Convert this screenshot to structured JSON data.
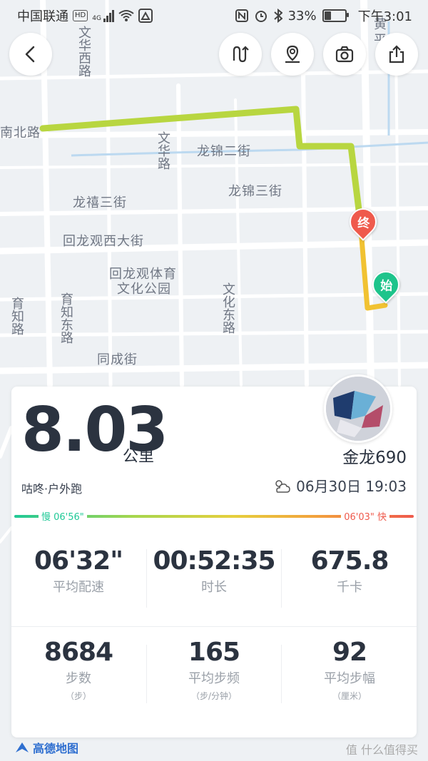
{
  "status_bar": {
    "carrier": "中国联通",
    "hd_badge": "HD",
    "network": "4G",
    "battery": "33%",
    "battery_level": 0.33,
    "time": "下午3:01"
  },
  "map": {
    "labels": {
      "wenhua_west": "文华西路",
      "north_road": "南北路",
      "wenhua_road": "文华路",
      "longjin_2": "龙锦二街",
      "longjin_3": "龙锦三街",
      "longxi_3": "龙禧三街",
      "huilongguan_west": "回龙观西大街",
      "park_1": "回龙观体育",
      "park_2": "文化公园",
      "yuzhi": "育知路",
      "yuzhi_east": "育知东路",
      "wenhua_east": "文化东路",
      "tongcheng": "同成街",
      "huangping_1": "黄",
      "huangping_2": "平"
    },
    "start_marker": "始",
    "end_marker": "终",
    "colors": {
      "start": "#1ec48b",
      "end": "#ef5a4c",
      "route": "#b8d640",
      "route_end": "#f1c232"
    }
  },
  "buttons": {
    "back": "back-arrow-icon",
    "route": "route-icon",
    "location": "location-pin-icon",
    "camera": "camera-icon",
    "share": "share-icon"
  },
  "summary": {
    "distance": "8.03",
    "distance_unit": "公里",
    "username": "金龙690",
    "activity": "咕咚·户外跑",
    "weather_icon": "cloudy-sun-icon",
    "date": "06月30日 19:03",
    "pace_slow_label": "慢 06'56\"",
    "pace_fast_label": "06'03\" 快",
    "colors": {
      "slow": "#20c997",
      "fast": "#ef5a4c"
    }
  },
  "stats": [
    {
      "value": "06'32\"",
      "label": "平均配速",
      "unit": ""
    },
    {
      "value": "00:52:35",
      "label": "时长",
      "unit": ""
    },
    {
      "value": "675.8",
      "label": "千卡",
      "unit": ""
    },
    {
      "value": "8684",
      "label": "步数",
      "unit": "（步）"
    },
    {
      "value": "165",
      "label": "平均步频",
      "unit": "（步/分钟）"
    },
    {
      "value": "92",
      "label": "平均步幅",
      "unit": "（厘米）"
    }
  ],
  "footer": {
    "map_logo": "高德地图",
    "watermark": "值 什么值得买"
  }
}
